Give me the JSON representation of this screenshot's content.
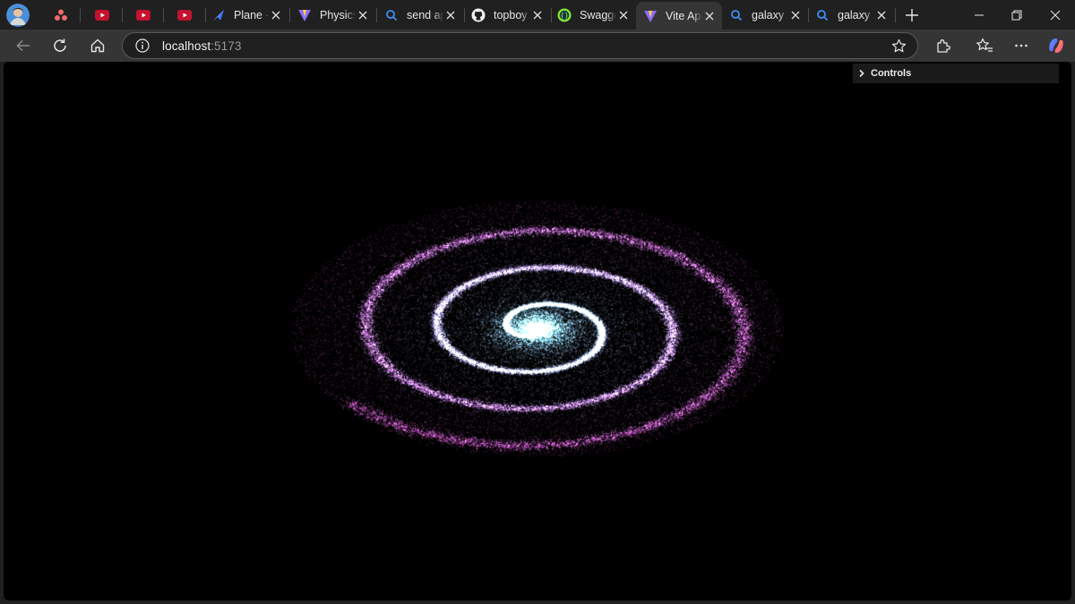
{
  "tabs": [
    {
      "label": "",
      "icon": "asana-icon",
      "color": "#f06a6a"
    },
    {
      "label": "",
      "icon": "youtube-icon",
      "color": "#ff0000"
    },
    {
      "label": "",
      "icon": "youtube-icon",
      "color": "#ff0000"
    },
    {
      "label": "",
      "icon": "youtube-icon",
      "color": "#ff0000"
    },
    {
      "label": "Plane - ",
      "icon": "plane-icon",
      "color": "#3f76ff"
    },
    {
      "label": "Physics",
      "icon": "vite-icon",
      "color": "#bd34fe"
    },
    {
      "label": "send ap",
      "icon": "search-icon",
      "color": "#3b8ff6"
    },
    {
      "label": "topboy",
      "icon": "github-icon",
      "color": "#ffffff"
    },
    {
      "label": "Swagge",
      "icon": "swagger-icon",
      "color": "#85ea2d"
    },
    {
      "label": "Vite App",
      "icon": "vite-icon",
      "color": "#bd34fe",
      "active": true
    },
    {
      "label": "galaxy - ",
      "icon": "search-icon",
      "color": "#3b8ff6"
    },
    {
      "label": "galaxy - ",
      "icon": "search-icon",
      "color": "#3b8ff6"
    }
  ],
  "address": {
    "host": "localhost",
    "port": ":5173"
  },
  "controls_panel": {
    "label": "Controls"
  },
  "colors": {
    "galaxy_inside": "#7ff6ff",
    "galaxy_outside": "#e35fe0",
    "background": "#000000"
  }
}
